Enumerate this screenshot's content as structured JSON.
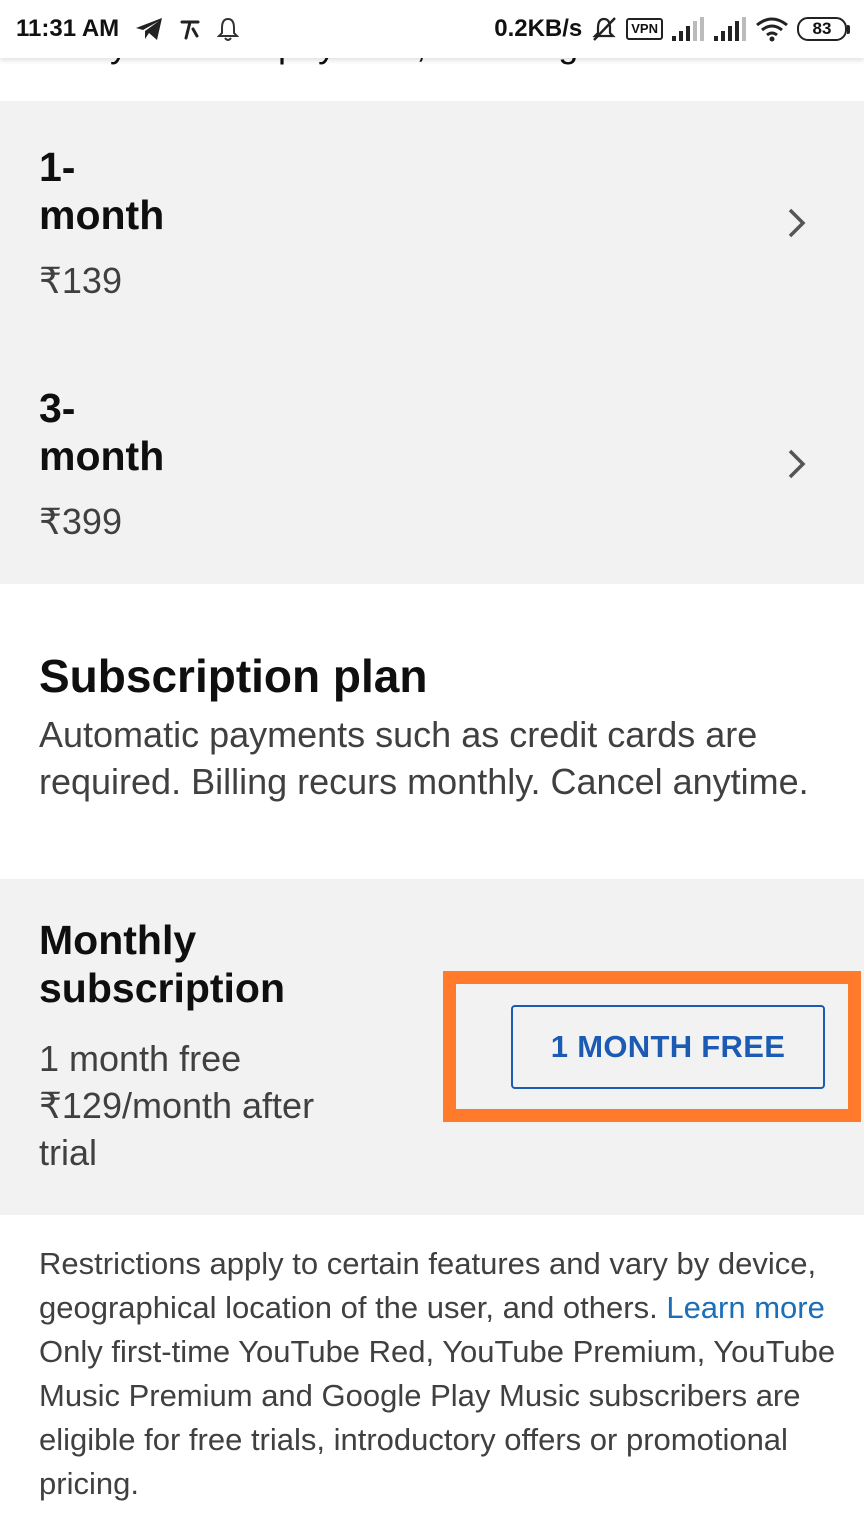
{
  "status_bar": {
    "time": "11:31 AM",
    "net_speed": "0.2KB/s",
    "vpn": "VPN",
    "battery": "83",
    "icons": [
      "telegram-icon",
      "t-app-icon",
      "bell-icon",
      "mute-icon",
      "signal-icon",
      "signal-icon",
      "wifi-icon",
      "battery-icon"
    ]
  },
  "top_clipped": "many forms of payment, including UPI.",
  "prepaid": {
    "items": [
      {
        "title_line1": "1-",
        "title_line2": "month",
        "price": "₹139"
      },
      {
        "title_line1": "3-",
        "title_line2": "month",
        "price": "₹399"
      }
    ]
  },
  "subscription": {
    "heading": "Subscription plan",
    "description": "Automatic payments such as credit cards are required. Billing recurs monthly. Cancel anytime.",
    "plan": {
      "title_line1": "Monthly",
      "title_line2": "subscription",
      "detail_line1": "1 month free",
      "detail_line2": "₹129/month after",
      "detail_line3": "trial",
      "button_label": "1 MONTH FREE"
    }
  },
  "footer": {
    "restrictions": "Restrictions apply to certain features and vary by device, geographical location of the user, and others.",
    "learn_more": "Learn more",
    "eligibility": "Only first-time YouTube Red, YouTube Premium, YouTube Music Premium and Google Play Music subscribers are eligible for free trials, introductory offers or promotional pricing."
  },
  "colors": {
    "accent_blue": "#1c5bb3",
    "highlight_orange": "#ff7a2a",
    "panel_gray": "#f2f2f2"
  }
}
